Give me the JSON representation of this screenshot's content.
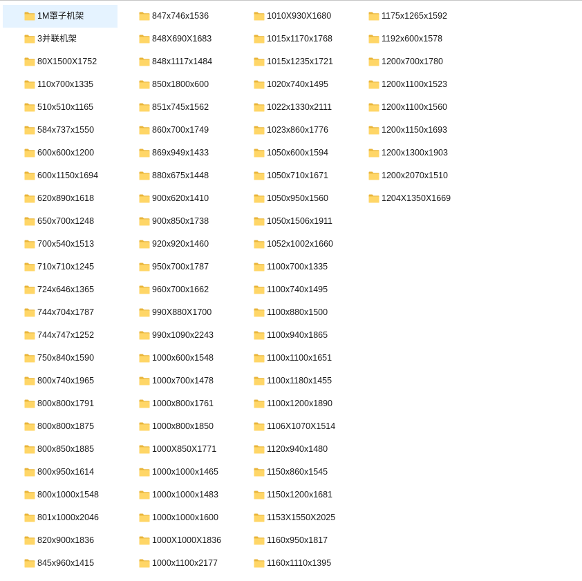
{
  "icon": "folder-icon",
  "colors": {
    "selection": "#e5f3ff",
    "folder_back": "#e9b53a",
    "folder_front": "#ffd667",
    "text": "#1a1a1a"
  },
  "folders": [
    {
      "name": "1M罩子机架",
      "selected": true
    },
    {
      "name": "3并联机架",
      "selected": false
    },
    {
      "name": "80X1500X1752",
      "selected": false
    },
    {
      "name": "110x700x1335",
      "selected": false
    },
    {
      "name": "510x510x1165",
      "selected": false
    },
    {
      "name": "584x737x1550",
      "selected": false
    },
    {
      "name": "600x600x1200",
      "selected": false
    },
    {
      "name": "600x1150x1694",
      "selected": false
    },
    {
      "name": "620x890x1618",
      "selected": false
    },
    {
      "name": "650x700x1248",
      "selected": false
    },
    {
      "name": "700x540x1513",
      "selected": false
    },
    {
      "name": "710x710x1245",
      "selected": false
    },
    {
      "name": "724x646x1365",
      "selected": false
    },
    {
      "name": "744x704x1787",
      "selected": false
    },
    {
      "name": "744x747x1252",
      "selected": false
    },
    {
      "name": "750x840x1590",
      "selected": false
    },
    {
      "name": "800x740x1965",
      "selected": false
    },
    {
      "name": "800x800x1791",
      "selected": false
    },
    {
      "name": "800x800x1875",
      "selected": false
    },
    {
      "name": "800x850x1885",
      "selected": false
    },
    {
      "name": "800x950x1614",
      "selected": false
    },
    {
      "name": "800x1000x1548",
      "selected": false
    },
    {
      "name": "801x1000x2046",
      "selected": false
    },
    {
      "name": "820x900x1836",
      "selected": false
    },
    {
      "name": "845x960x1415",
      "selected": false
    },
    {
      "name": "847x746x1536",
      "selected": false
    },
    {
      "name": "848X690X1683",
      "selected": false
    },
    {
      "name": "848x1117x1484",
      "selected": false
    },
    {
      "name": "850x1800x600",
      "selected": false
    },
    {
      "name": "851x745x1562",
      "selected": false
    },
    {
      "name": "860x700x1749",
      "selected": false
    },
    {
      "name": "869x949x1433",
      "selected": false
    },
    {
      "name": "880x675x1448",
      "selected": false
    },
    {
      "name": "900x620x1410",
      "selected": false
    },
    {
      "name": "900x850x1738",
      "selected": false
    },
    {
      "name": "920x920x1460",
      "selected": false
    },
    {
      "name": "950x700x1787",
      "selected": false
    },
    {
      "name": "960x700x1662",
      "selected": false
    },
    {
      "name": "990X880X1700",
      "selected": false
    },
    {
      "name": "990x1090x2243",
      "selected": false
    },
    {
      "name": "1000x600x1548",
      "selected": false
    },
    {
      "name": "1000x700x1478",
      "selected": false
    },
    {
      "name": "1000x800x1761",
      "selected": false
    },
    {
      "name": "1000x800x1850",
      "selected": false
    },
    {
      "name": "1000X850X1771",
      "selected": false
    },
    {
      "name": "1000x1000x1465",
      "selected": false
    },
    {
      "name": "1000x1000x1483",
      "selected": false
    },
    {
      "name": "1000x1000x1600",
      "selected": false
    },
    {
      "name": "1000X1000X1836",
      "selected": false
    },
    {
      "name": "1000x1100x2177",
      "selected": false
    },
    {
      "name": "1010X930X1680",
      "selected": false
    },
    {
      "name": "1015x1170x1768",
      "selected": false
    },
    {
      "name": "1015x1235x1721",
      "selected": false
    },
    {
      "name": "1020x740x1495",
      "selected": false
    },
    {
      "name": "1022x1330x2111",
      "selected": false
    },
    {
      "name": "1023x860x1776",
      "selected": false
    },
    {
      "name": "1050x600x1594",
      "selected": false
    },
    {
      "name": "1050x710x1671",
      "selected": false
    },
    {
      "name": "1050x950x1560",
      "selected": false
    },
    {
      "name": "1050x1506x1911",
      "selected": false
    },
    {
      "name": "1052x1002x1660",
      "selected": false
    },
    {
      "name": "1100x700x1335",
      "selected": false
    },
    {
      "name": "1100x740x1495",
      "selected": false
    },
    {
      "name": "1100x880x1500",
      "selected": false
    },
    {
      "name": "1100x940x1865",
      "selected": false
    },
    {
      "name": "1100x1100x1651",
      "selected": false
    },
    {
      "name": "1100x1180x1455",
      "selected": false
    },
    {
      "name": "1100x1200x1890",
      "selected": false
    },
    {
      "name": "1106X1070X1514",
      "selected": false
    },
    {
      "name": "1120x940x1480",
      "selected": false
    },
    {
      "name": "1150x860x1545",
      "selected": false
    },
    {
      "name": "1150x1200x1681",
      "selected": false
    },
    {
      "name": "1153X1550X2025",
      "selected": false
    },
    {
      "name": "1160x950x1817",
      "selected": false
    },
    {
      "name": "1160x1110x1395",
      "selected": false
    },
    {
      "name": "1175x1265x1592",
      "selected": false
    },
    {
      "name": "1192x600x1578",
      "selected": false
    },
    {
      "name": "1200x700x1780",
      "selected": false
    },
    {
      "name": "1200x1100x1523",
      "selected": false
    },
    {
      "name": "1200x1100x1560",
      "selected": false
    },
    {
      "name": "1200x1150x1693",
      "selected": false
    },
    {
      "name": "1200x1300x1903",
      "selected": false
    },
    {
      "name": "1200x2070x1510",
      "selected": false
    },
    {
      "name": "1204X1350X1669",
      "selected": false
    }
  ]
}
